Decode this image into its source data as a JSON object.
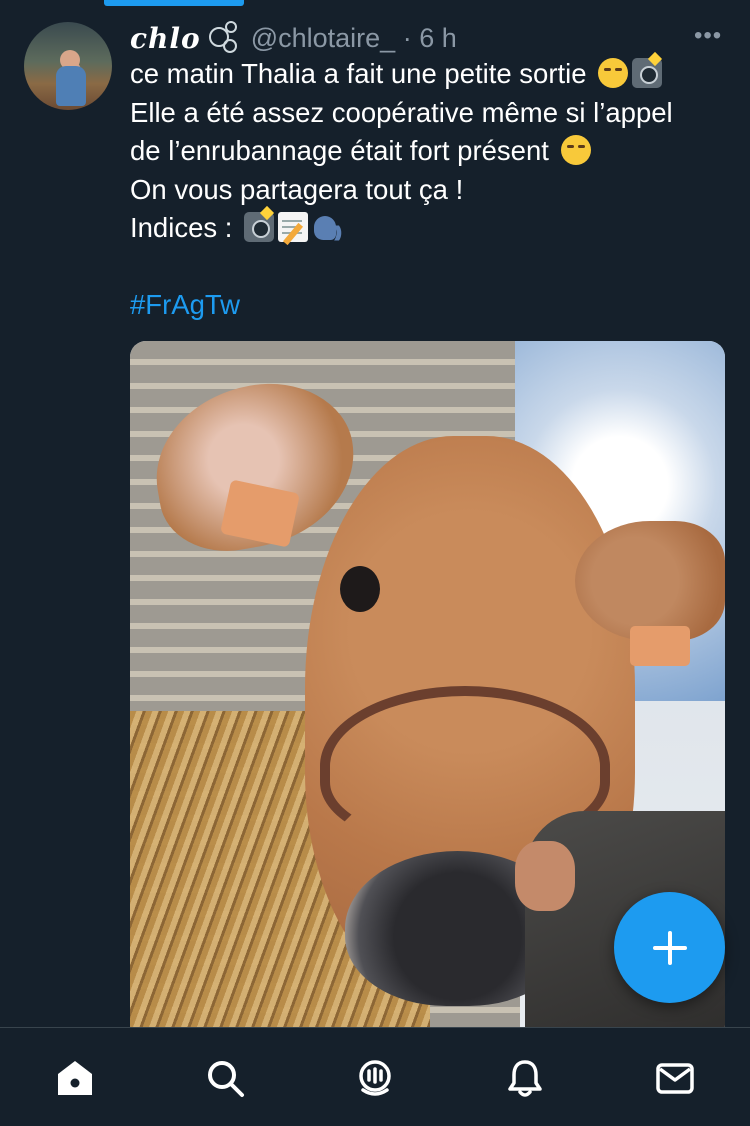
{
  "tweet": {
    "display_name": "chlo",
    "handle": "@chlotaire_",
    "time": " · 6 h",
    "more": "•••",
    "lines": [
      "ce matin Thalia a fait une petite sortie",
      "Elle a été assez coopérative même si l’appel",
      "de l’enrubannage était fort présent",
      "On vous partagera tout ça !",
      "Indices :"
    ],
    "hashtag": "#FrAgTw",
    "emojis": {
      "line1": [
        "smirk-emoji",
        "camera-flash-emoji"
      ],
      "line3": [
        "yum-emoji"
      ],
      "line5": [
        "camera-flash-emoji",
        "memo-emoji",
        "speaking-head-emoji"
      ]
    }
  },
  "nav": {
    "tabs": [
      "home",
      "search",
      "spaces",
      "notifications",
      "messages"
    ],
    "active": "home"
  },
  "colors": {
    "background": "#15202b",
    "accent": "#1d9bf0",
    "muted": "#8b98a5"
  }
}
